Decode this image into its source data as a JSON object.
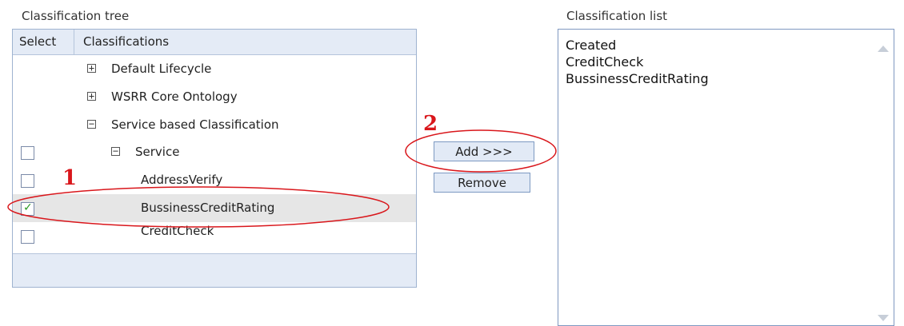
{
  "tree_section": {
    "label": "Classification tree",
    "header": {
      "select": "Select",
      "classifications": "Classifications"
    },
    "rows": [
      {
        "expander": "+",
        "label": "Default Lifecycle",
        "checkbox": false
      },
      {
        "expander": "+",
        "label": "WSRR Core Ontology",
        "checkbox": false
      },
      {
        "expander": "−",
        "label": "Service based Classification",
        "checkbox": false
      },
      {
        "expander": "−",
        "label": "Service",
        "checkbox": true,
        "checked": false
      },
      {
        "label": "AddressVerify",
        "checkbox": true,
        "checked": false
      },
      {
        "label": "BussinessCreditRating",
        "checkbox": true,
        "checked": true
      },
      {
        "label": "CreditCheck",
        "checkbox": true,
        "checked": false
      }
    ]
  },
  "buttons": {
    "add": "Add >>>",
    "remove": "Remove"
  },
  "list_section": {
    "label": "Classification list",
    "items": [
      "Created",
      "CreditCheck",
      "BussinessCreditRating"
    ]
  },
  "annotations": {
    "step1": "1",
    "step2": "2",
    "color": "#d9161b"
  }
}
